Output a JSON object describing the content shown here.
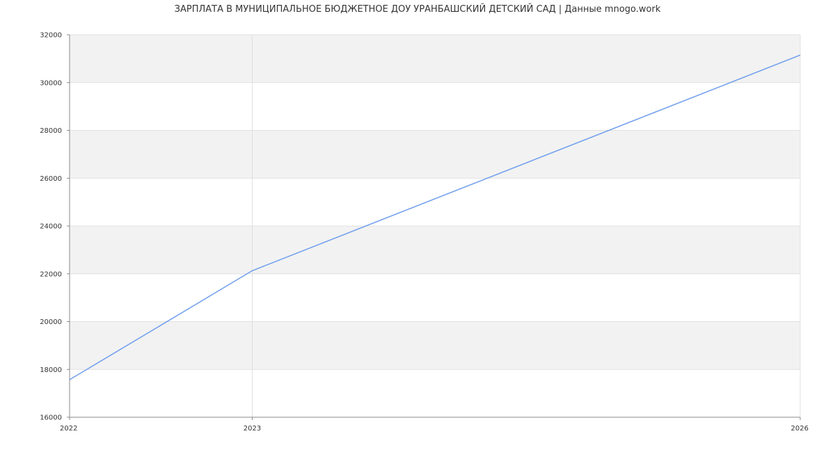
{
  "title": "ЗАРПЛАТА В МУНИЦИПАЛЬНОЕ БЮДЖЕТНОЕ ДОУ УРАНБАШСКИЙ ДЕТСКИЙ САД | Данные mnogo.work",
  "chart_data": {
    "type": "line",
    "title": "ЗАРПЛАТА В МУНИЦИПАЛЬНОЕ БЮДЖЕТНОЕ ДОУ УРАНБАШСКИЙ ДЕТСКИЙ САД | Данные mnogo.work",
    "x": [
      "2022",
      "2023",
      "2026"
    ],
    "series": [
      {
        "values": [
          17570,
          22130,
          31150
        ],
        "color": "#6e9ded"
      }
    ],
    "ylim": [
      16000,
      32000
    ],
    "yticks": [
      16000,
      18000,
      20000,
      22000,
      24000,
      26000,
      28000,
      30000,
      32000
    ],
    "xticks": [
      "2022",
      "2023",
      "2026"
    ],
    "grid": true,
    "band_color": "#f2f2f2",
    "grid_color": "#e0e0e0",
    "axis_color": "#888888"
  }
}
